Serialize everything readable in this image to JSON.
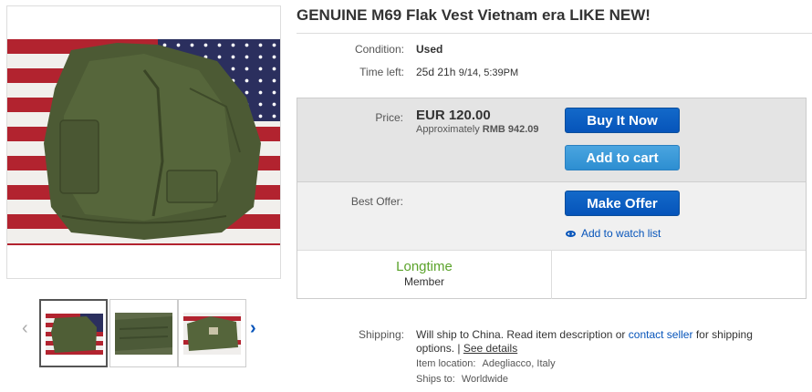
{
  "listing": {
    "title": "GENUINE M69 Flak Vest Vietnam era LIKE NEW!"
  },
  "condition": {
    "label": "Condition:",
    "value": "Used"
  },
  "time_left": {
    "label": "Time left:",
    "value": "25d 21h",
    "end": "9/14, 5:39PM"
  },
  "price": {
    "label": "Price:",
    "value": "EUR 120.00",
    "approx_prefix": "Approximately",
    "approx_value": "RMB 942.09"
  },
  "actions": {
    "buy_it_now": "Buy It Now",
    "add_to_cart": "Add to cart",
    "make_offer": "Make Offer",
    "add_to_watch": "Add to watch list"
  },
  "best_offer": {
    "label": "Best Offer:"
  },
  "seller_badge": {
    "title": "Longtime",
    "subtitle": "Member"
  },
  "shipping": {
    "label": "Shipping:",
    "text_before": "Will ship to China. Read item description or",
    "contact_link": "contact seller",
    "text_after": "for shipping",
    "line2": "options. |",
    "see_details": "See details",
    "item_location_label": "Item location:",
    "item_location": "Adegliacco, Italy",
    "ships_to_label": "Ships to:",
    "ships_to": "Worldwide"
  },
  "gallery": {
    "prev_icon": "chevron-left-icon",
    "next_icon": "chevron-right-icon",
    "thumbnail_count": 3
  },
  "colors": {
    "link": "#0654ba",
    "button_blue": "#0654ba",
    "button_light": "#2d8ed1",
    "longtime_green": "#5ba32b"
  }
}
